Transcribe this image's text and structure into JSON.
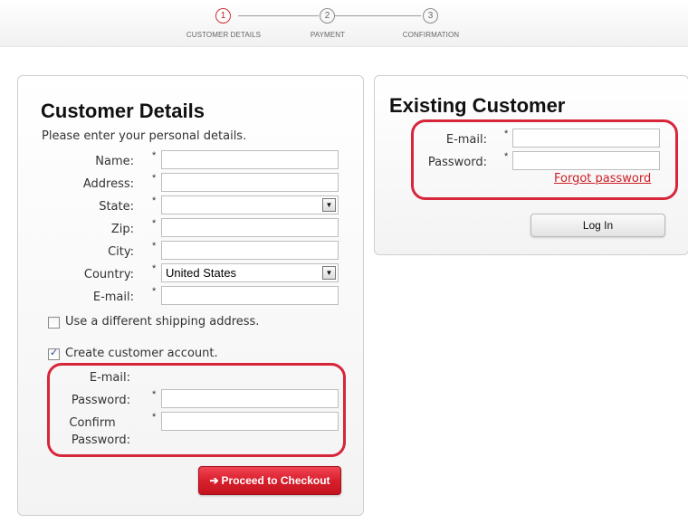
{
  "steps": [
    {
      "number": "1",
      "label": "CUSTOMER DETAILS",
      "active": true
    },
    {
      "number": "2",
      "label": "PAYMENT",
      "active": false
    },
    {
      "number": "3",
      "label": "CONFIRMATION",
      "active": false
    }
  ],
  "customer_details": {
    "title": "Customer Details",
    "subtitle": "Please enter your personal details.",
    "fields": {
      "name": {
        "label": "Name:",
        "required": "*",
        "value": ""
      },
      "address": {
        "label": "Address:",
        "required": "*",
        "value": ""
      },
      "state": {
        "label": "State:",
        "required": "*",
        "value": ""
      },
      "zip": {
        "label": "Zip:",
        "required": "*",
        "value": ""
      },
      "city": {
        "label": "City:",
        "required": "*",
        "value": ""
      },
      "country": {
        "label": "Country:",
        "required": "*",
        "value": "United States"
      },
      "email": {
        "label": "E-mail:",
        "required": "*",
        "value": ""
      }
    },
    "shipping_checkbox": {
      "label": "Use a different shipping address.",
      "checked": false
    },
    "account_checkbox": {
      "label": "Create customer account.",
      "checked": true
    },
    "account": {
      "email_label": "E-mail:",
      "password_label": "Password:",
      "password_required": "*",
      "confirm_label_1": "Confirm",
      "confirm_label_2": "Password:",
      "confirm_required": "*"
    },
    "checkout_button": "Proceed to Checkout"
  },
  "existing_customer": {
    "title": "Existing Customer",
    "email_label": "E-mail:",
    "email_required": "*",
    "password_label": "Password:",
    "password_required": "*",
    "forgot_link": "Forgot password",
    "login_button": "Log In"
  },
  "colors": {
    "accent_red": "#d7263a",
    "button_red": "#d9202d",
    "link_red": "#cc1f26"
  }
}
